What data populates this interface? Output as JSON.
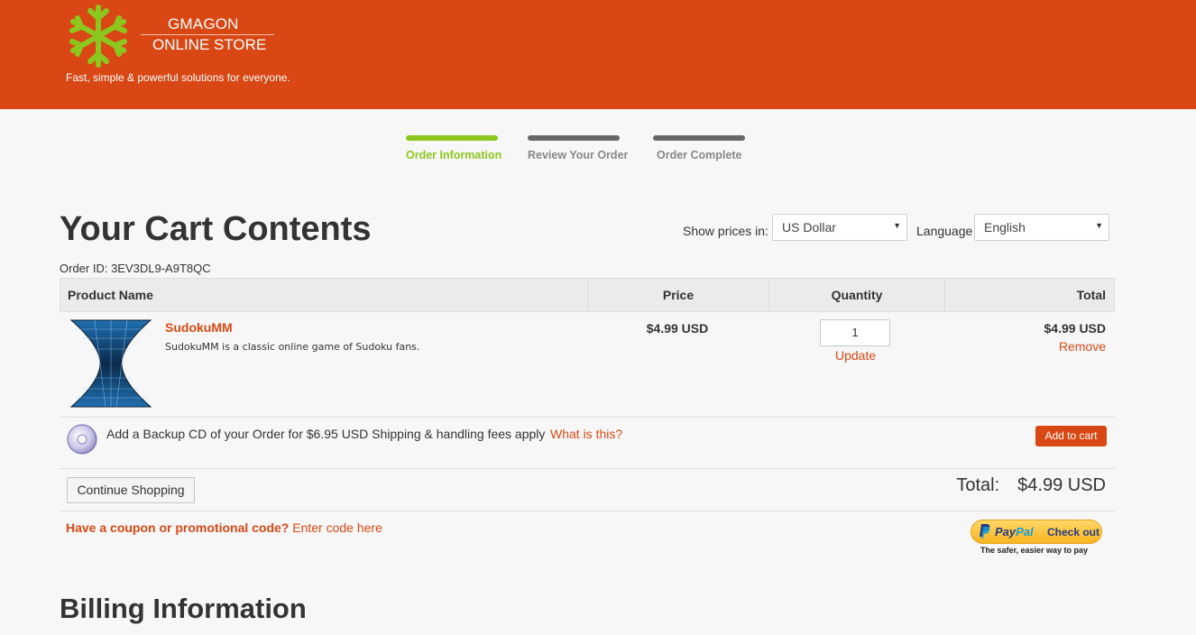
{
  "header": {
    "brand_line1": "GMAGON",
    "brand_line2": "ONLINE STORE",
    "tagline": "Fast, simple & powerful solutions for everyone."
  },
  "steps": [
    {
      "label": "Order Information",
      "active": true
    },
    {
      "label": "Review Your Order",
      "active": false
    },
    {
      "label": "Order Complete",
      "active": false
    }
  ],
  "page_title": "Your Cart Contents",
  "currency": {
    "label": "Show prices in:",
    "value": "US Dollar"
  },
  "language": {
    "label": "Language",
    "value": "English"
  },
  "order_id": "Order ID: 3EV3DL9-A9T8QC",
  "table": {
    "headers": [
      "Product Name",
      "Price",
      "Quantity",
      "Total"
    ],
    "items": [
      {
        "name": "SudokuMM",
        "description": "SudokuMM is a classic online game of Sudoku fans.",
        "price": "$4.99 USD",
        "quantity": "1",
        "update_label": "Update",
        "total": "$4.99 USD",
        "remove_label": "Remove"
      }
    ]
  },
  "backup_cd": {
    "text": "Add a Backup CD of your Order for $6.95 USD Shipping & handling fees apply",
    "what_label": "What is this?",
    "add_label": "Add to cart"
  },
  "continue_label": "Continue Shopping",
  "total": {
    "label": "Total:",
    "value": "$4.99 USD"
  },
  "coupon": {
    "question": "Have a coupon or promotional code?",
    "link": "Enter code here"
  },
  "paypal": {
    "pay": "Pay",
    "pal": "Pal",
    "checkout": "Check out",
    "tagline": "The safer, easier way to pay"
  },
  "billing_title": "Billing Information",
  "colors": {
    "brand": "#d94814",
    "accent": "#8cc71f",
    "paypal_blue": "#253b80"
  }
}
